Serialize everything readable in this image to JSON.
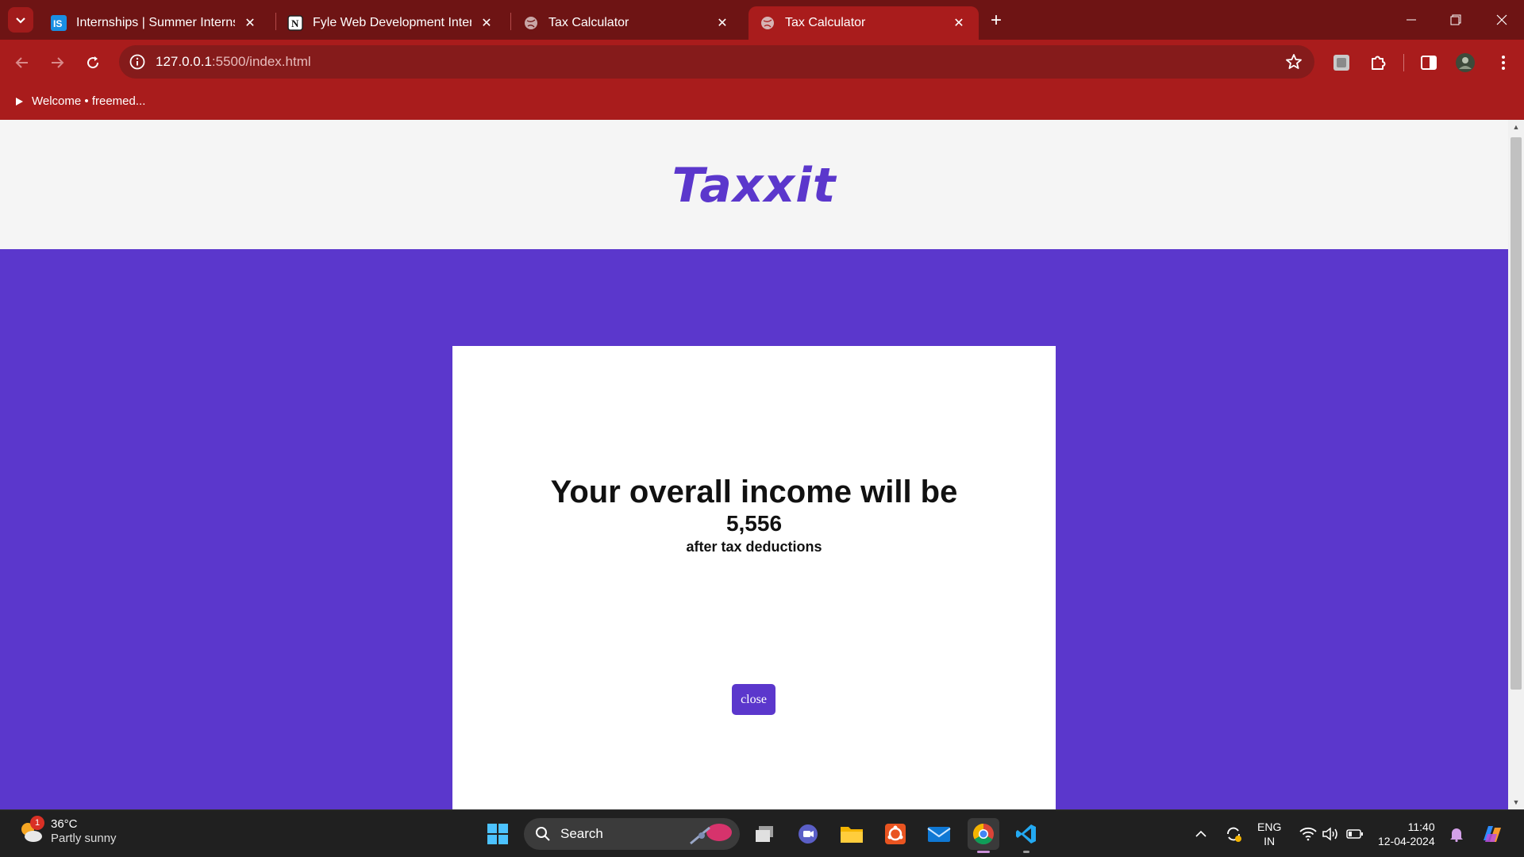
{
  "browser": {
    "tabs": [
      {
        "title": "Internships | Summer Internship",
        "favicon": "internshala-icon",
        "active": false
      },
      {
        "title": "Fyle Web Development Internship",
        "favicon": "notion-icon",
        "active": false
      },
      {
        "title": "Tax Calculator",
        "favicon": "globe-icon",
        "active": false
      },
      {
        "title": "Tax Calculator",
        "favicon": "globe-icon",
        "active": true
      }
    ],
    "url_host": "127.0.0.1",
    "url_path": ":5500/index.html",
    "bookmark": "Welcome • freemed...",
    "colors": {
      "frame": "#6e1414",
      "toolbar": "#a91c1c",
      "omnibox": "#851b1b"
    }
  },
  "page": {
    "logo": "Taxxit",
    "modal": {
      "heading": "Your overall income will be",
      "amount": "5,556",
      "subtext": "after tax deductions",
      "close_label": "close"
    },
    "colors": {
      "accent": "#5b37cc",
      "header_bg": "#f5f5f5"
    }
  },
  "taskbar": {
    "weather": {
      "temp": "36°C",
      "condition": "Partly sunny",
      "badge": "1"
    },
    "search_placeholder": "Search",
    "language": {
      "line1": "ENG",
      "line2": "IN"
    },
    "clock": {
      "time": "11:40",
      "date": "12-04-2024"
    }
  }
}
